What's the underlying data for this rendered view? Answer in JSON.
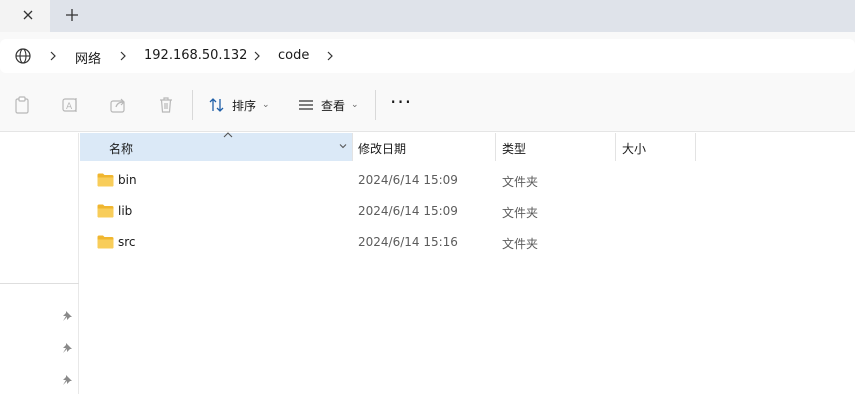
{
  "tabs": {
    "close_icon": "close-icon",
    "new_tab_icon": "plus-icon"
  },
  "address": {
    "location_icon": "globe-icon",
    "crumbs": [
      "网络",
      "192.168.50.132",
      "code"
    ]
  },
  "toolbar": {
    "sort_label": "排序",
    "view_label": "查看",
    "more_label": "···"
  },
  "columns": {
    "name": "名称",
    "modified": "修改日期",
    "type": "类型",
    "size": "大小"
  },
  "files": [
    {
      "name": "bin",
      "modified": "2024/6/14 15:09",
      "type": "文件夹"
    },
    {
      "name": "lib",
      "modified": "2024/6/14 15:09",
      "type": "文件夹"
    },
    {
      "name": "src",
      "modified": "2024/6/14 15:16",
      "type": "文件夹"
    }
  ],
  "colors": {
    "header_selected": "#dbe9f7",
    "folder": "#f5c04a"
  }
}
